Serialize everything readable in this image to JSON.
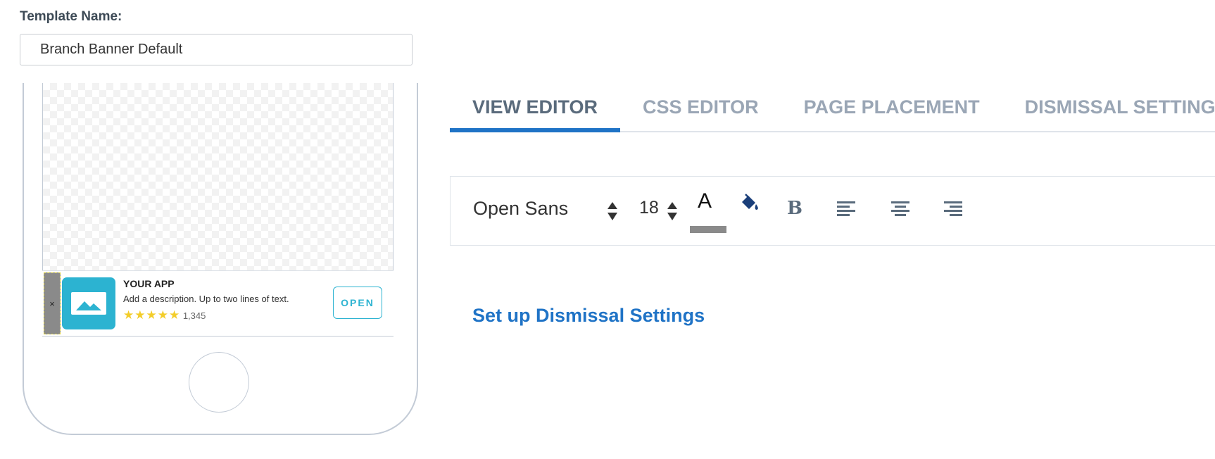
{
  "template": {
    "label": "Template Name:",
    "name_value": "Branch Banner Default"
  },
  "preview": {
    "banner": {
      "close_glyph": "×",
      "title": "YOUR APP",
      "description": "Add a description. Up to two lines of text.",
      "stars": "★★★★★",
      "rating_count": "1,345",
      "open_label": "OPEN",
      "icon": "image-icon",
      "accent_color": "#2cb3d1",
      "star_color": "#f3cd2a"
    }
  },
  "tabs": [
    {
      "label": "VIEW EDITOR",
      "active": true
    },
    {
      "label": "CSS EDITOR",
      "active": false
    },
    {
      "label": "PAGE PLACEMENT",
      "active": false
    },
    {
      "label": "DISMISSAL SETTINGS",
      "active": false
    }
  ],
  "toolbar": {
    "font_family": "Open Sans",
    "font_size": "18",
    "text_color_letter": "A",
    "text_color_swatch": "#8a8a8a",
    "fill_icon": "paint-bucket-icon",
    "bold_label": "B",
    "align_icons": [
      "align-left-icon",
      "align-center-icon",
      "align-right-icon"
    ]
  },
  "dismiss_link": "Set up Dismissal Settings",
  "colors": {
    "accent": "#1f73c6",
    "tab_inactive": "#9aa6b5",
    "tab_active": "#5a6b7c"
  }
}
